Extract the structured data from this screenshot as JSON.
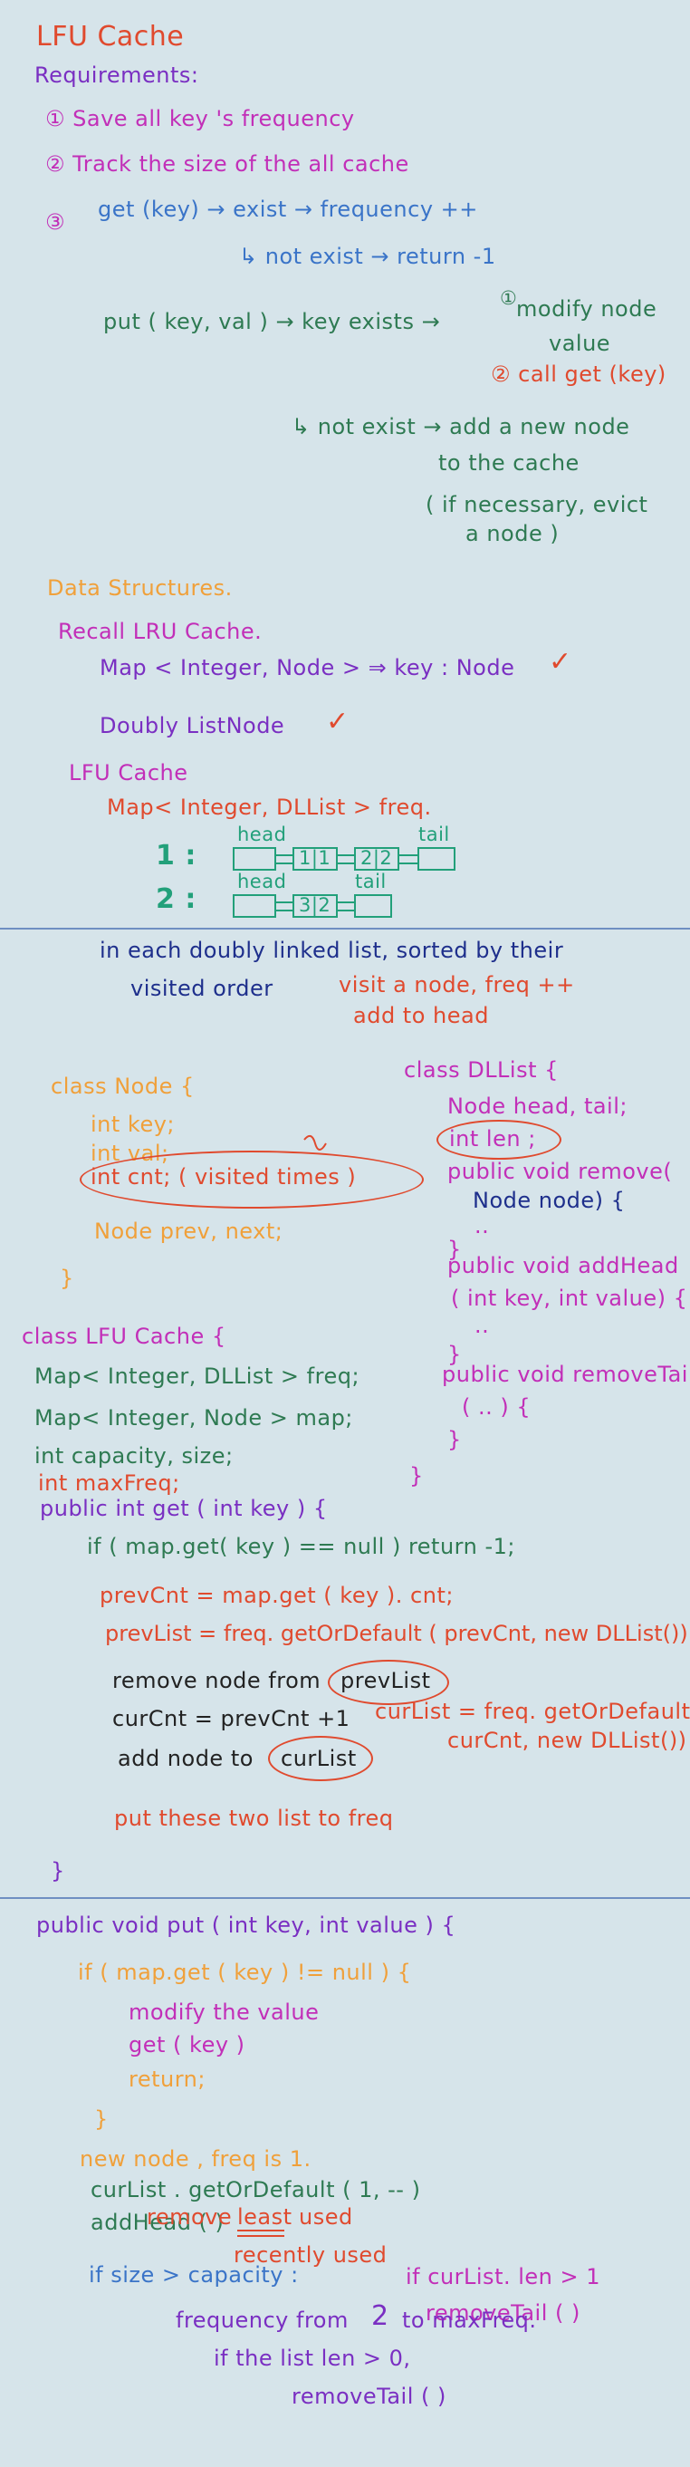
{
  "colors": {
    "background": "#d6e4ea",
    "red": "#e04a2e",
    "orange": "#f0a03a",
    "magenta": "#c22fb8",
    "purple": "#7a2fc2",
    "green": "#2e7a52",
    "teal": "#22a07a",
    "blue": "#3a74c8",
    "dark": "#222222",
    "navy": "#1e2f8c",
    "rule": "#6f8fc2"
  },
  "section1": {
    "title": "LFU  Cache",
    "requirements": "Requirements:",
    "req1": "① Save  all  key 's  frequency",
    "req2": "② Track  the  size  of  the  all  cache",
    "req3_num": "③",
    "req3_get": "get (key)  →  exist  →  frequency ++",
    "req3_not": "↳ not exist  →  return  -1",
    "put_line": "put ( key, val )  →  key  exists  →",
    "put_modify_num": "①",
    "put_modify": "modify node",
    "put_value": "value",
    "put_call": "② call get (key)",
    "put_not_exist": "↳ not exist  →  add  a new node",
    "put_to_cache": "to the cache",
    "put_evict": "( if necessary,  evict",
    "put_node": "a  node )"
  },
  "section2": {
    "title": "Data   Structures.",
    "recall": "Recall   LRU   Cache.",
    "map_line": "Map < Integer,  Node >  ⇒  key :  Node",
    "dll": "Doubly  ListNode",
    "check_mark": "✓",
    "lfu": "LFU  Cache",
    "freq_map": "Map< Integer, DLList >  freq.",
    "row1_num": "1 :",
    "row2_num": "2 :",
    "head_label": "head",
    "tail_label": "tail",
    "node_1_1": "1|1",
    "node_2_2": "2|2",
    "node_3_2": "3|2"
  },
  "section3": {
    "line1": "in  each  doubly  linked  list,  sorted  by  their",
    "line2a": "visited   order",
    "line2b": "visit  a  node,  freq ++",
    "line3": "add  to  head",
    "node_class": "class  Node  {",
    "node_key": "int  key;",
    "node_val": "int  val;",
    "node_cnt": "int  cnt; ( visited  times )",
    "node_prev": "Node  prev,  next;",
    "node_close": "}",
    "dll_class": "class  DLList  {",
    "dll_fields": "Node  head,  tail;",
    "dll_len": "int  len ;",
    "dll_remove": "public  void  remove(",
    "dll_remove_arg": "Node  node)  {",
    "dll_dots1": "..",
    "dll_close1": "}",
    "dll_addhead": "public  void  addHead",
    "dll_addhead_args": "( int key,  int value) {",
    "dll_dots2": "..",
    "dll_close2": "}",
    "dll_removetail": "public  void  removeTail",
    "dll_removetail_args": "( .. )  {",
    "dll_close3": "}",
    "dll_close4": "}",
    "lfu_class": "class  LFU  Cache  {",
    "lfu_freq": "Map< Integer,  DLList >  freq;",
    "lfu_map": "Map< Integer,  Node >  map;",
    "lfu_cap": "int  capacity,  size;",
    "lfu_maxfreq": "int  maxFreq;",
    "get_sig": "public  int  get ( int key ) {",
    "get_if": "if ( map.get( key ) == null )  return  -1;",
    "get_prevcnt": "prevCnt  =   map.get ( key ).  cnt;",
    "get_prevlist": "prevList  =  freq.  getOrDefault ( prevCnt,  new DLList())",
    "get_remove": "remove   node   from",
    "get_remove_target": "prevList",
    "get_curcnt": "curCnt   = prevCnt +1",
    "get_curlist1": "curList =  freq. getOrDefault(",
    "get_curlist2": "curCnt,  new  DLList())",
    "get_add": "add   node  to",
    "get_add_target": "curList",
    "get_put": "put   these   two   list   to  freq",
    "get_close": "}"
  },
  "section4": {
    "put_sig": "public  void  put ( int key,  int value ) {",
    "if_line": "if ( map.get ( key )  !=  null ) {",
    "modify": "modify  the  value",
    "get": "get ( key )",
    "ret": "return;",
    "close_if": "}",
    "new_node": "new  node ,   freq  is  1.",
    "curlist": "curList .   getOrDefault ( 1,  -- )",
    "addhead": "addHead ( )",
    "if_size": "if   size  >  capacity :",
    "if_curlist": "if   curList. len > 1",
    "removetail1": "removeTail ( )",
    "remove_prefix": "remove",
    "remove_least": "least",
    "remove_suffix": "used",
    "recently": "recently   used",
    "frequency": "frequency   from",
    "two": "2",
    "to_max": "to  maxFreq.",
    "if_list": "if   the  list  len > 0,",
    "removetail2": "removeTail  ( )"
  }
}
